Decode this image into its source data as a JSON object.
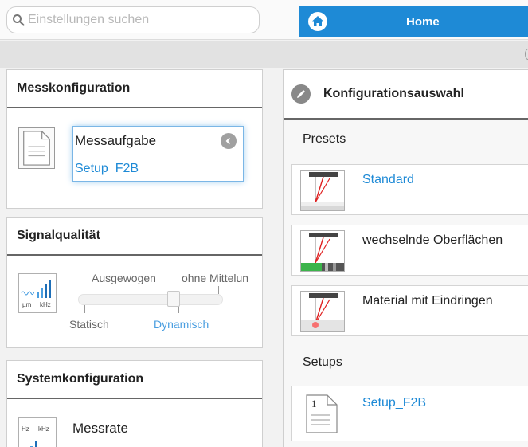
{
  "search": {
    "placeholder": "Einstellungen suchen"
  },
  "nav": {
    "home_label": "Home"
  },
  "messkonfiguration": {
    "title": "Messkonfiguration",
    "task_title": "Messaufgabe",
    "task_value": "Setup_F2B"
  },
  "signalqualitaet": {
    "title": "Signalqualität",
    "icon_units": [
      "µm",
      "kHz"
    ],
    "options": [
      "Statisch",
      "Ausgewogen",
      "Dynamisch",
      "ohne Mittelun"
    ],
    "selected": "Dynamisch"
  },
  "systemkonfiguration": {
    "title": "Systemkonfiguration",
    "icon_units": [
      "Hz",
      "kHz"
    ],
    "messrate_label": "Messrate"
  },
  "konfigurationsauswahl": {
    "title": "Konfigurationsauswahl",
    "presets_label": "Presets",
    "presets": [
      "Standard",
      "wechselnde Oberflächen",
      "Material mit Eindringen"
    ],
    "setups_label": "Setups",
    "setups": [
      "Setup_F2B"
    ]
  },
  "colors": {
    "accent": "#1e8ad6",
    "link": "#1e8ad6",
    "laser": "#e02020",
    "green": "#3cb44b"
  }
}
